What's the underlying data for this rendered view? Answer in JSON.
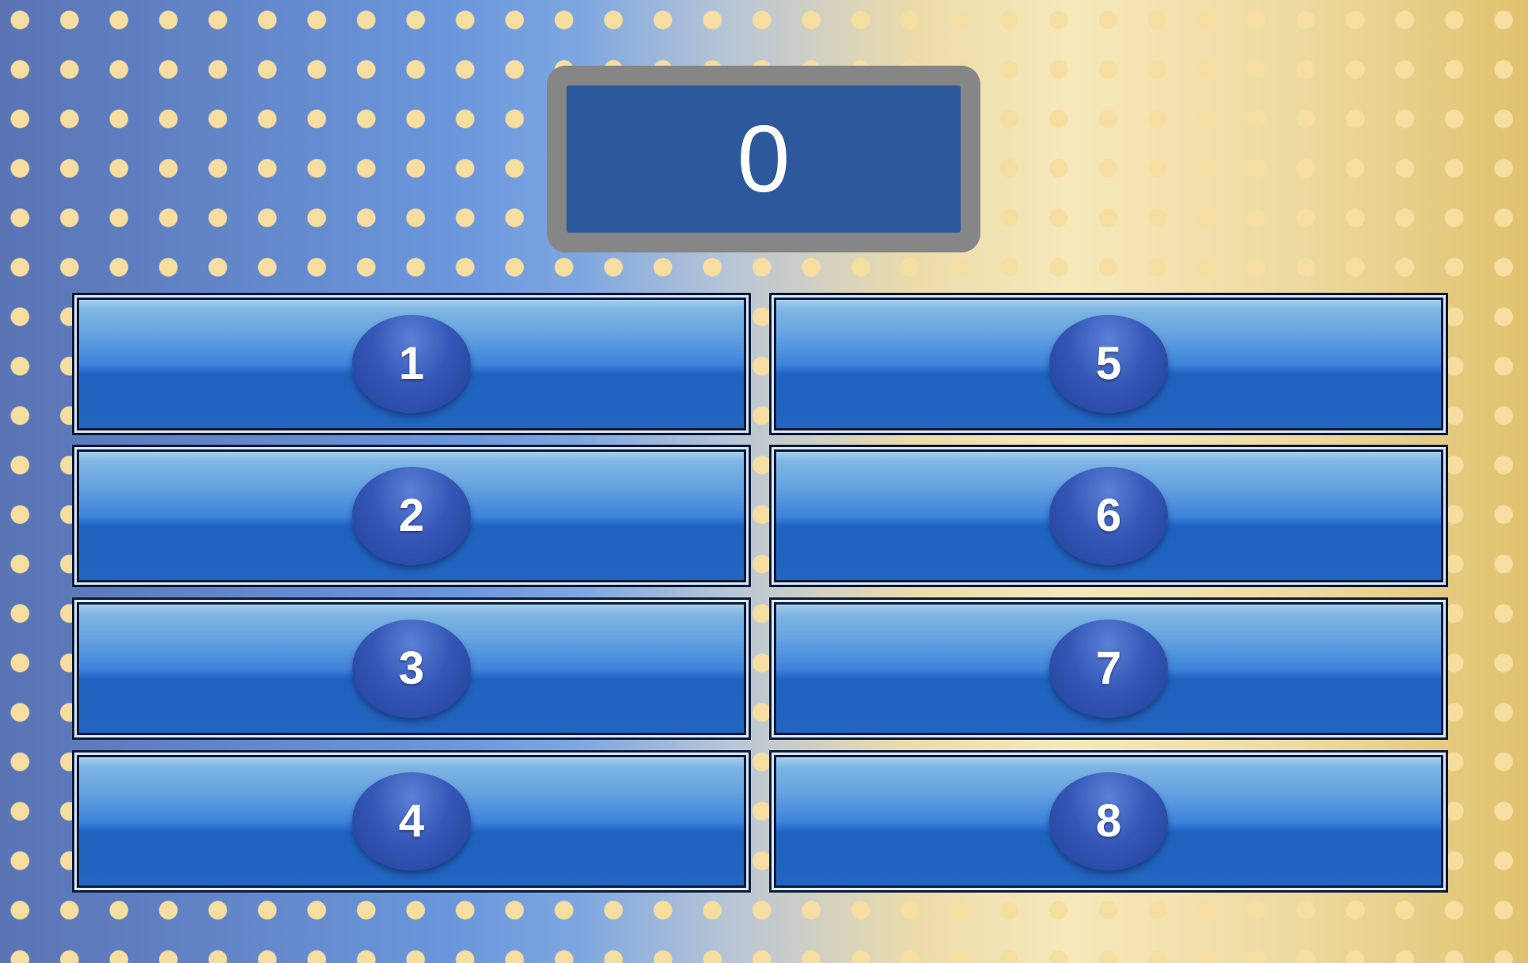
{
  "score": {
    "value": "0"
  },
  "answers": {
    "left": [
      {
        "label": "1"
      },
      {
        "label": "2"
      },
      {
        "label": "3"
      },
      {
        "label": "4"
      }
    ],
    "right": [
      {
        "label": "5"
      },
      {
        "label": "6"
      },
      {
        "label": "7"
      },
      {
        "label": "8"
      }
    ]
  },
  "colors": {
    "background_left": "#5a74b4",
    "background_right": "#e0c26e",
    "dot": "#f6dea0",
    "score_frame": "#868686",
    "score_screen": "#1e52a0",
    "slot_blue": "#2265c0",
    "oval_blue": "#3558b8"
  }
}
